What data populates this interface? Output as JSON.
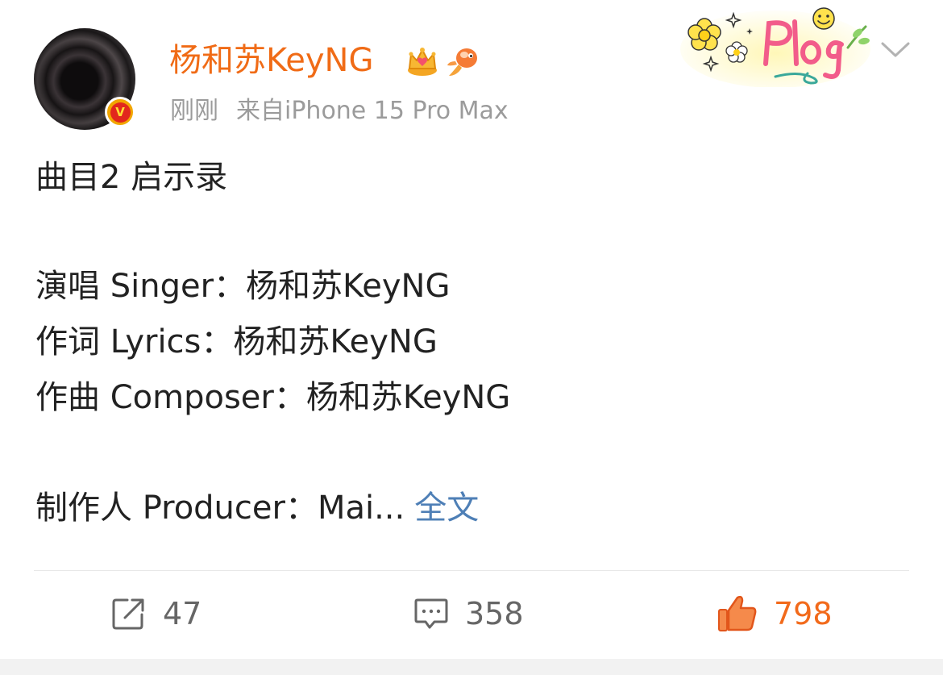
{
  "post": {
    "author": "杨和苏KeyNG",
    "time": "刚刚",
    "source": "来自iPhone 15 Pro Max",
    "verified_badge": "V",
    "card_sticker_text": "Plog",
    "icons": [
      "crown-icon",
      "fish-icon",
      "verified-icon",
      "chevron-down-icon"
    ],
    "content_lines": [
      "曲目2 启示录",
      "演唱 Singer：杨和苏KeyNG",
      "作词 Lyrics：杨和苏KeyNG",
      "作曲 Composer：杨和苏KeyNG",
      "制作人 Producer：Mai..."
    ],
    "more_link": "全文"
  },
  "actions": {
    "repost": {
      "icon": "repost-icon",
      "count": "47"
    },
    "comment": {
      "icon": "comment-icon",
      "count": "358"
    },
    "like": {
      "icon": "thumbs-up-icon",
      "count": "798"
    }
  },
  "colors": {
    "username": "#f06b16",
    "meta": "#9b9b9b",
    "link": "#4e7fb6",
    "like_active": "#f26a1b",
    "text": "#222222"
  }
}
